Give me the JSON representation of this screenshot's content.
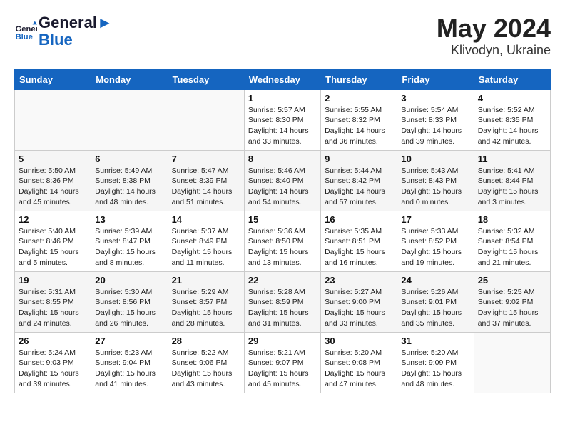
{
  "logo": {
    "line1": "General",
    "line2": "Blue"
  },
  "title": "May 2024",
  "location": "Klivodyn, Ukraine",
  "days_of_week": [
    "Sunday",
    "Monday",
    "Tuesday",
    "Wednesday",
    "Thursday",
    "Friday",
    "Saturday"
  ],
  "weeks": [
    [
      {
        "day": "",
        "info": ""
      },
      {
        "day": "",
        "info": ""
      },
      {
        "day": "",
        "info": ""
      },
      {
        "day": "1",
        "info": "Sunrise: 5:57 AM\nSunset: 8:30 PM\nDaylight: 14 hours\nand 33 minutes."
      },
      {
        "day": "2",
        "info": "Sunrise: 5:55 AM\nSunset: 8:32 PM\nDaylight: 14 hours\nand 36 minutes."
      },
      {
        "day": "3",
        "info": "Sunrise: 5:54 AM\nSunset: 8:33 PM\nDaylight: 14 hours\nand 39 minutes."
      },
      {
        "day": "4",
        "info": "Sunrise: 5:52 AM\nSunset: 8:35 PM\nDaylight: 14 hours\nand 42 minutes."
      }
    ],
    [
      {
        "day": "5",
        "info": "Sunrise: 5:50 AM\nSunset: 8:36 PM\nDaylight: 14 hours\nand 45 minutes."
      },
      {
        "day": "6",
        "info": "Sunrise: 5:49 AM\nSunset: 8:38 PM\nDaylight: 14 hours\nand 48 minutes."
      },
      {
        "day": "7",
        "info": "Sunrise: 5:47 AM\nSunset: 8:39 PM\nDaylight: 14 hours\nand 51 minutes."
      },
      {
        "day": "8",
        "info": "Sunrise: 5:46 AM\nSunset: 8:40 PM\nDaylight: 14 hours\nand 54 minutes."
      },
      {
        "day": "9",
        "info": "Sunrise: 5:44 AM\nSunset: 8:42 PM\nDaylight: 14 hours\nand 57 minutes."
      },
      {
        "day": "10",
        "info": "Sunrise: 5:43 AM\nSunset: 8:43 PM\nDaylight: 15 hours\nand 0 minutes."
      },
      {
        "day": "11",
        "info": "Sunrise: 5:41 AM\nSunset: 8:44 PM\nDaylight: 15 hours\nand 3 minutes."
      }
    ],
    [
      {
        "day": "12",
        "info": "Sunrise: 5:40 AM\nSunset: 8:46 PM\nDaylight: 15 hours\nand 5 minutes."
      },
      {
        "day": "13",
        "info": "Sunrise: 5:39 AM\nSunset: 8:47 PM\nDaylight: 15 hours\nand 8 minutes."
      },
      {
        "day": "14",
        "info": "Sunrise: 5:37 AM\nSunset: 8:49 PM\nDaylight: 15 hours\nand 11 minutes."
      },
      {
        "day": "15",
        "info": "Sunrise: 5:36 AM\nSunset: 8:50 PM\nDaylight: 15 hours\nand 13 minutes."
      },
      {
        "day": "16",
        "info": "Sunrise: 5:35 AM\nSunset: 8:51 PM\nDaylight: 15 hours\nand 16 minutes."
      },
      {
        "day": "17",
        "info": "Sunrise: 5:33 AM\nSunset: 8:52 PM\nDaylight: 15 hours\nand 19 minutes."
      },
      {
        "day": "18",
        "info": "Sunrise: 5:32 AM\nSunset: 8:54 PM\nDaylight: 15 hours\nand 21 minutes."
      }
    ],
    [
      {
        "day": "19",
        "info": "Sunrise: 5:31 AM\nSunset: 8:55 PM\nDaylight: 15 hours\nand 24 minutes."
      },
      {
        "day": "20",
        "info": "Sunrise: 5:30 AM\nSunset: 8:56 PM\nDaylight: 15 hours\nand 26 minutes."
      },
      {
        "day": "21",
        "info": "Sunrise: 5:29 AM\nSunset: 8:57 PM\nDaylight: 15 hours\nand 28 minutes."
      },
      {
        "day": "22",
        "info": "Sunrise: 5:28 AM\nSunset: 8:59 PM\nDaylight: 15 hours\nand 31 minutes."
      },
      {
        "day": "23",
        "info": "Sunrise: 5:27 AM\nSunset: 9:00 PM\nDaylight: 15 hours\nand 33 minutes."
      },
      {
        "day": "24",
        "info": "Sunrise: 5:26 AM\nSunset: 9:01 PM\nDaylight: 15 hours\nand 35 minutes."
      },
      {
        "day": "25",
        "info": "Sunrise: 5:25 AM\nSunset: 9:02 PM\nDaylight: 15 hours\nand 37 minutes."
      }
    ],
    [
      {
        "day": "26",
        "info": "Sunrise: 5:24 AM\nSunset: 9:03 PM\nDaylight: 15 hours\nand 39 minutes."
      },
      {
        "day": "27",
        "info": "Sunrise: 5:23 AM\nSunset: 9:04 PM\nDaylight: 15 hours\nand 41 minutes."
      },
      {
        "day": "28",
        "info": "Sunrise: 5:22 AM\nSunset: 9:06 PM\nDaylight: 15 hours\nand 43 minutes."
      },
      {
        "day": "29",
        "info": "Sunrise: 5:21 AM\nSunset: 9:07 PM\nDaylight: 15 hours\nand 45 minutes."
      },
      {
        "day": "30",
        "info": "Sunrise: 5:20 AM\nSunset: 9:08 PM\nDaylight: 15 hours\nand 47 minutes."
      },
      {
        "day": "31",
        "info": "Sunrise: 5:20 AM\nSunset: 9:09 PM\nDaylight: 15 hours\nand 48 minutes."
      },
      {
        "day": "",
        "info": ""
      }
    ]
  ]
}
